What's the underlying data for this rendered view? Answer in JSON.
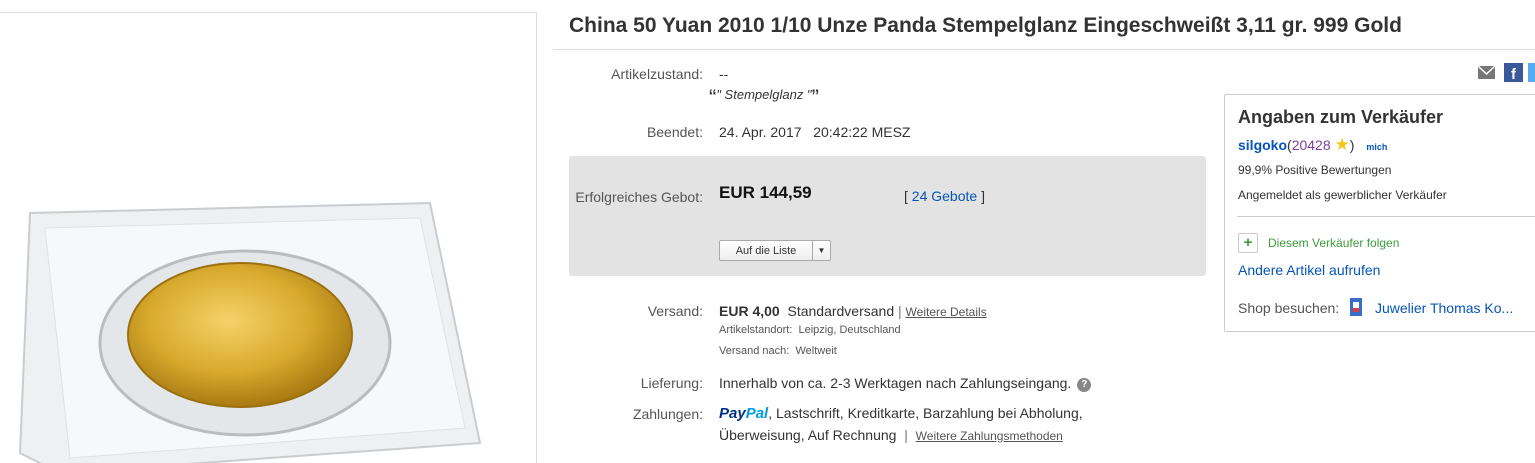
{
  "item": {
    "title": "China 50 Yuan 2010 1/10 Unze Panda Stempelglanz Eingeschweißt 3,11 gr. 999 Gold"
  },
  "condition": {
    "label": "Artikelzustand:",
    "value": "--",
    "quote_open": "“",
    "quote_text": "\" Stempelglanz \"",
    "quote_close": "”"
  },
  "ended": {
    "label": "Beendet:",
    "date": "24. Apr. 2017",
    "time": "20:42:22 MESZ"
  },
  "bid": {
    "label": "Erfolgreiches Gebot:",
    "price": "EUR 144,59",
    "bids_open": "[",
    "bids_link": "24 Gebote",
    "bids_close": "]",
    "watch_button": "Auf die Liste"
  },
  "shipping": {
    "label": "Versand:",
    "price": "EUR 4,00",
    "method": "Standardversand",
    "separator": "|",
    "details_link": "Weitere Details",
    "location_label": "Artikelstandort:",
    "location": "Leipzig, Deutschland",
    "ships_to_label": "Versand nach:",
    "ships_to": "Weltweit"
  },
  "delivery": {
    "label": "Lieferung:",
    "value": "Innerhalb von ca. 2-3 Werktagen nach Zahlungseingang.",
    "help": "?"
  },
  "payments": {
    "label": "Zahlungen:",
    "paypal_pay": "Pay",
    "paypal_pal": "Pal",
    "line1": ", Lastschrift, Kreditkarte, Barzahlung bei Abholung,",
    "line2": "Überweisung, Auf Rechnung",
    "separator": "|",
    "more_link": "Weitere Zahlungsmethoden"
  },
  "seller": {
    "heading": "Angaben zum Verkäufer",
    "name": "silgoko",
    "score_open": "(",
    "score": "20428",
    "score_close": ")",
    "me_badge": "mich",
    "positive": "99,9% Positive Bewertungen",
    "type": "Angemeldet als gewerblicher Verkäufer",
    "follow": "Diesem Verkäufer folgen",
    "follow_icon": "+",
    "other_items": "Andere Artikel aufrufen",
    "shop_label": "Shop besuchen:",
    "shop_name": "Juwelier Thomas Ko..."
  },
  "colors": {
    "link": "#0654ba",
    "paypal_dark": "#003087",
    "paypal_light": "#009cde",
    "star": "#f5c518",
    "follow_green": "#3a9b3a"
  },
  "icons": [
    "email-icon",
    "facebook-icon",
    "twitter-icon",
    "star-icon",
    "follow-plus-icon",
    "shop-icon",
    "help-icon",
    "chevron-down-icon"
  ]
}
